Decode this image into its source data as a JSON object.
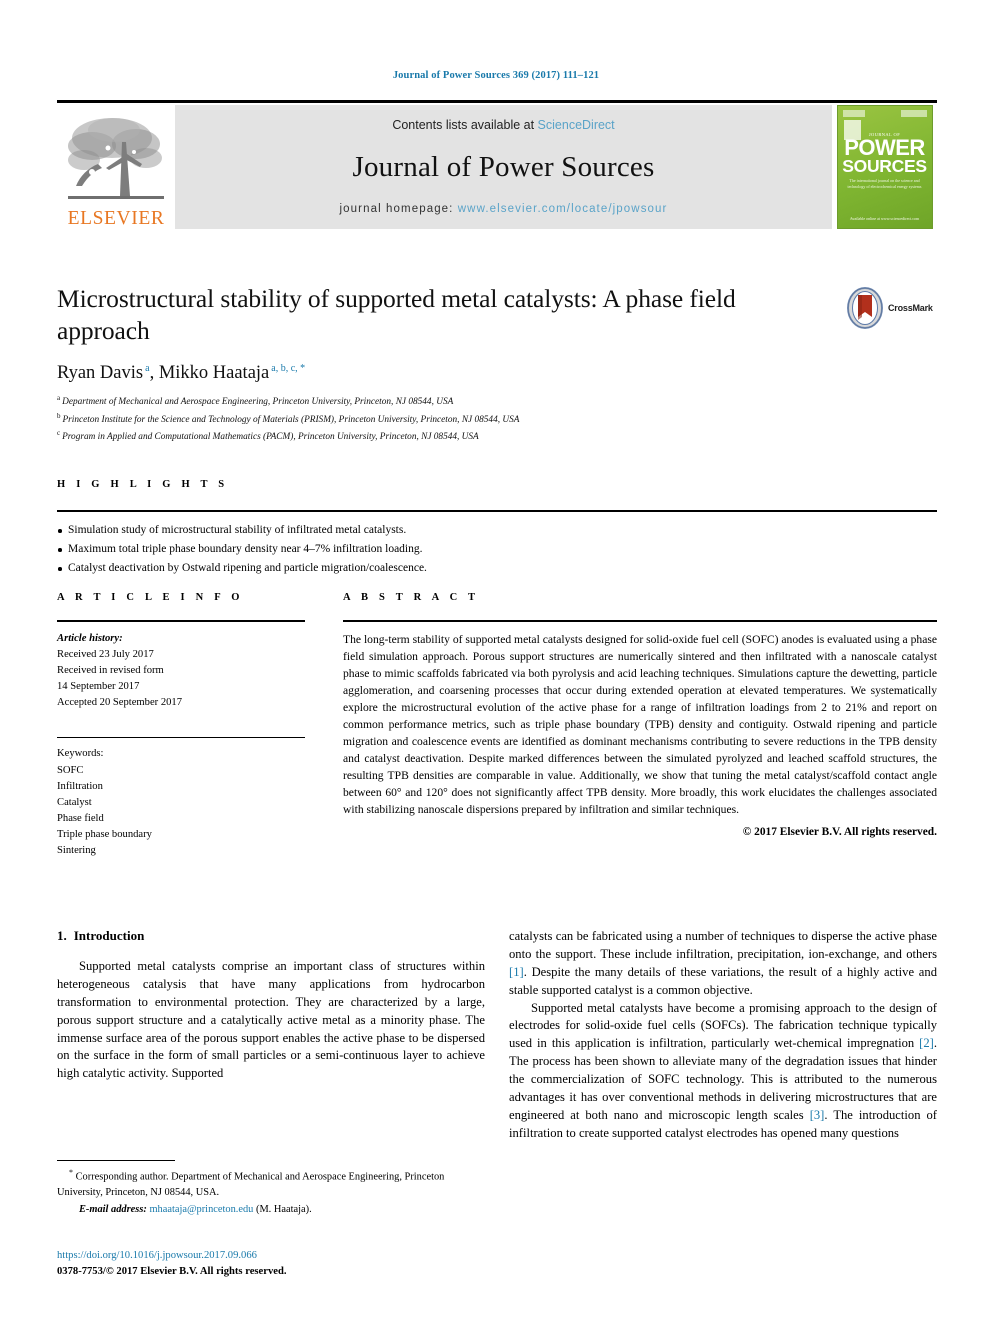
{
  "running_head": "Journal of Power Sources 369 (2017) 111–121",
  "masthead": {
    "contents_prefix": "Contents lists available at ",
    "contents_link": "ScienceDirect",
    "journal_name": "Journal of Power Sources",
    "homepage_prefix": "journal homepage: ",
    "homepage_url": "www.elsevier.com/locate/jpowsour",
    "publisher_name": "ELSEVIER",
    "publisher_logo_icon": "elsevier-tree-icon",
    "cover": {
      "kicker": "JOURNAL OF",
      "title_line1": "POWER",
      "title_line2": "SOURCES",
      "subtitle": "The international journal on the science and technology of electrochemical energy systems",
      "footer": "Available online at\nwww.sciencedirect.com"
    }
  },
  "article": {
    "title": "Microstructural stability of supported metal catalysts: A phase field approach",
    "crossmark_label": "CrossMark",
    "crossmark_icon": "crossmark-badge-icon",
    "authors": [
      {
        "name": "Ryan Davis",
        "marks": "a"
      },
      {
        "name": "Mikko Haataja",
        "marks": "a, b, c, *"
      }
    ],
    "authors_separator": ", ",
    "affiliations": [
      {
        "mark": "a",
        "text": "Department of Mechanical and Aerospace Engineering, Princeton University, Princeton, NJ 08544, USA"
      },
      {
        "mark": "b",
        "text": "Princeton Institute for the Science and Technology of Materials (PRISM), Princeton University, Princeton, NJ 08544, USA"
      },
      {
        "mark": "c",
        "text": "Program in Applied and Computational Mathematics (PACM), Princeton University, Princeton, NJ 08544, USA"
      }
    ]
  },
  "highlights": {
    "label": "H I G H L I G H T S",
    "items": [
      "Simulation study of microstructural stability of infiltrated metal catalysts.",
      "Maximum total triple phase boundary density near 4–7% infiltration loading.",
      "Catalyst deactivation by Ostwald ripening and particle migration/coalescence."
    ]
  },
  "article_info": {
    "label": "A R T I C L E   I N F O",
    "history_label": "Article history:",
    "history_lines": [
      "Received 23 July 2017",
      "Received in revised form",
      "14 September 2017",
      "Accepted 20 September 2017"
    ],
    "keywords_label": "Keywords:",
    "keywords": [
      "SOFC",
      "Infiltration",
      "Catalyst",
      "Phase field",
      "Triple phase boundary",
      "Sintering"
    ]
  },
  "abstract": {
    "label": "A B S T R A C T",
    "text": "The long-term stability of supported metal catalysts designed for solid-oxide fuel cell (SOFC) anodes is evaluated using a phase field simulation approach. Porous support structures are numerically sintered and then infiltrated with a nanoscale catalyst phase to mimic scaffolds fabricated via both pyrolysis and acid leaching techniques. Simulations capture the dewetting, particle agglomeration, and coarsening processes that occur during extended operation at elevated temperatures. We systematically explore the microstructural evolution of the active phase for a range of infiltration loadings from 2 to 21% and report on common performance metrics, such as triple phase boundary (TPB) density and contiguity. Ostwald ripening and particle migration and coalescence events are identified as dominant mechanisms contributing to severe reductions in the TPB density and catalyst deactivation. Despite marked differences between the simulated pyrolyzed and leached scaffold structures, the resulting TPB densities are comparable in value. Additionally, we show that tuning the metal catalyst/scaffold contact angle between 60° and 120° does not significantly affect TPB density. More broadly, this work elucidates the challenges associated with stabilizing nanoscale dispersions prepared by infiltration and similar techniques.",
    "copyright": "© 2017 Elsevier B.V. All rights reserved."
  },
  "body": {
    "section_number": "1.",
    "section_title": "Introduction",
    "left_paragraphs": [
      "Supported metal catalysts comprise an important class of structures within heterogeneous catalysis that have many applications from hydrocarbon transformation to environmental protection. They are characterized by a large, porous support structure and a catalytically active metal as a minority phase. The immense surface area of the porous support enables the active phase to be dispersed on the surface in the form of small particles or a semi-continuous layer to achieve high catalytic activity. Supported"
    ],
    "right_paragraphs": [
      {
        "pre": "catalysts can be fabricated using a number of techniques to disperse the active phase onto the support. These include infiltration, precipitation, ion-exchange, and others ",
        "cite": "[1]",
        "post": ". Despite the many details of these variations, the result of a highly active and stable supported catalyst is a common objective.",
        "indent": false
      },
      {
        "pre": "Supported metal catalysts have become a promising approach to the design of electrodes for solid-oxide fuel cells (SOFCs). The fabrication technique typically used in this application is infiltration, particularly wet-chemical impregnation ",
        "cite": "[2]",
        "mid": ". The process has been shown to alleviate many of the degradation issues that hinder the commercialization of SOFC technology. This is attributed to the numerous advantages it has over conventional methods in delivering microstructures that are engineered at both nano and microscopic length scales ",
        "cite2": "[3]",
        "post": ". The introduction of infiltration to create supported catalyst electrodes has opened many questions",
        "indent": true
      }
    ]
  },
  "footnote": {
    "marker": "*",
    "text": "Corresponding author. Department of Mechanical and Aerospace Engineering, Princeton University, Princeton, NJ 08544, USA.",
    "email_label": "E-mail address:",
    "email": "mhaataja@princeton.edu",
    "email_owner": "(M. Haataja)."
  },
  "imprint": {
    "doi": "https://doi.org/10.1016/j.jpowsour.2017.09.066",
    "issn_line": "0378-7753/© 2017 Elsevier B.V. All rights reserved."
  },
  "colors": {
    "link_blue": "#1a7aab",
    "sd_blue": "#5aa3c8",
    "elsevier_orange": "#e87722",
    "cover_green": "#8bbf3d",
    "masthead_gray": "#e3e3e3"
  }
}
